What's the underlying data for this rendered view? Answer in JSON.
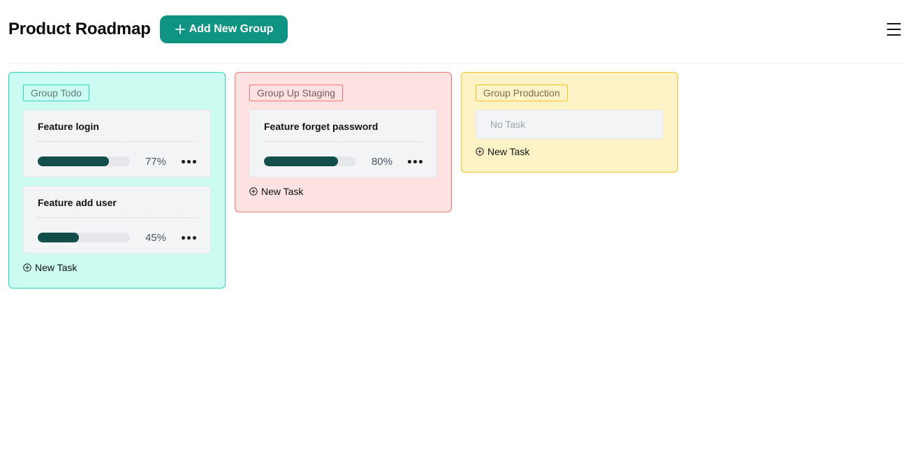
{
  "header": {
    "title": "Product Roadmap",
    "add_group_label": "Add New Group",
    "add_icon": "plus-icon",
    "menu_icon": "hamburger-menu-icon"
  },
  "groups": [
    {
      "label": "Group Todo",
      "color": "#ccfbf1",
      "tasks": [
        {
          "title": "Feature login",
          "progress": 77,
          "progress_label": "77%"
        },
        {
          "title": "Feature add user",
          "progress": 45,
          "progress_label": "45%"
        }
      ],
      "new_task_label": "New Task"
    },
    {
      "label": "Group Up Staging",
      "color": "#fee2e2",
      "tasks": [
        {
          "title": "Feature forget password",
          "progress": 80,
          "progress_label": "80%"
        }
      ],
      "new_task_label": "New Task"
    },
    {
      "label": "Group Production",
      "color": "#fef3c7",
      "tasks": [],
      "empty_label": "No Task",
      "new_task_label": "New Task"
    }
  ],
  "colors": {
    "accent": "#0f9484",
    "progress_fill": "#134e4a",
    "progress_track": "#e5e7eb"
  }
}
